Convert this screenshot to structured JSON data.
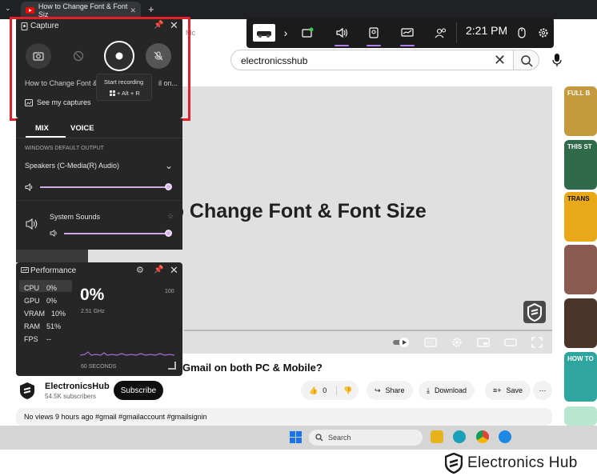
{
  "browser": {
    "tab_title": "How to Change Font & Font Siz",
    "address_fragment": "Mc"
  },
  "youtube": {
    "search_value": "electronicsshub",
    "video_overlay_title": "w to Change Font & Font Size",
    "video_heading": "Gmail on both PC & Mobile?",
    "channel_name": "ElectronicsHub",
    "channel_subs": "54.5K subscribers",
    "subscribe_label": "Subscribe",
    "like_count": "0",
    "share_label": "Share",
    "download_label": "Download",
    "save_label": "Save",
    "description": "No views  9 hours ago  #gmail #gmailaccount #gmailsignin",
    "thumbnails": [
      "FULL B",
      "THIS ST",
      "TRANS",
      "",
      "",
      "HOW TO"
    ]
  },
  "taskbar": {
    "search_placeholder": "Search"
  },
  "footer": {
    "brand": "Electronics Hub"
  },
  "gamebar": {
    "time": "2:21 PM"
  },
  "capture": {
    "title": "Capture",
    "app_name": "How to Change Font &",
    "app_name_tail": "il on...",
    "tooltip_title": "Start recording",
    "tooltip_shortcut": "+ Alt + R",
    "see_captures": "See my captures"
  },
  "audio": {
    "tabs": [
      "MIX",
      "VOICE"
    ],
    "section_label": "WINDOWS DEFAULT OUTPUT",
    "output_device": "Speakers (C-Media(R) Audio)",
    "app_label": "System Sounds",
    "master_volume": 1.0,
    "system_sounds_volume": 1.0
  },
  "performance": {
    "title": "Performance",
    "rows": [
      {
        "label": "CPU",
        "value": "0%"
      },
      {
        "label": "GPU",
        "value": "0%"
      },
      {
        "label": "VRAM",
        "value": "10%"
      },
      {
        "label": "RAM",
        "value": "51%"
      },
      {
        "label": "FPS",
        "value": "--"
      }
    ],
    "big_value": "0%",
    "clock": "2.51 GHz",
    "max_label": "100",
    "duration_label": "60 SECONDS"
  },
  "colors": {
    "accent": "#b180e6",
    "highlight_red": "#e0202a",
    "panel_bg": "#262626"
  }
}
